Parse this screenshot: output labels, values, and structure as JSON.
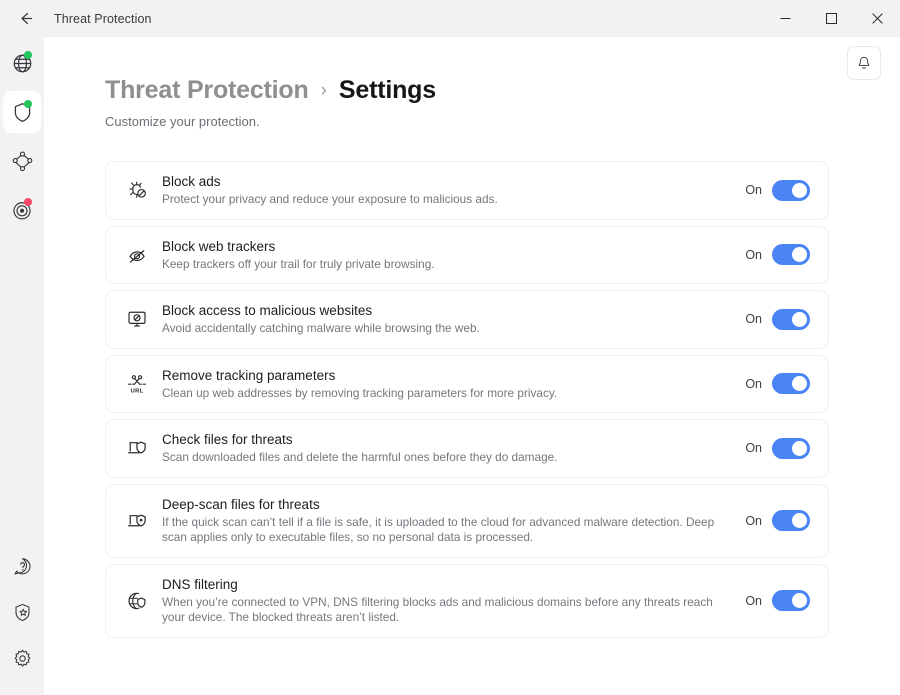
{
  "window": {
    "title": "Threat Protection",
    "back_icon": "back-arrow-icon",
    "minimize_label": "—",
    "maximize_label": "□",
    "close_label": "✕"
  },
  "sidebar": {
    "top_items": [
      {
        "name": "globe-icon",
        "label": "VPN",
        "badge": "green",
        "selected": false
      },
      {
        "name": "shield-icon",
        "label": "Threat Protection",
        "badge": "green",
        "selected": true
      },
      {
        "name": "mesh-network-icon",
        "label": "Meshnet",
        "badge": "none",
        "selected": false
      },
      {
        "name": "radar-icon",
        "label": "Dark Web Monitor",
        "badge": "red",
        "selected": false
      }
    ],
    "bottom_items": [
      {
        "name": "help-icon",
        "label": "Help"
      },
      {
        "name": "shield-star-icon",
        "label": "What's new"
      },
      {
        "name": "gear-icon",
        "label": "Settings"
      }
    ]
  },
  "header": {
    "notification_icon": "bell-icon",
    "breadcrumb_parent": "Threat Protection",
    "breadcrumb_separator": "›",
    "breadcrumb_current": "Settings",
    "subtitle": "Customize your protection."
  },
  "accent_color": "#4a84f5",
  "settings": [
    {
      "icon": "bug-blocked-icon",
      "title": "Block ads",
      "description": "Protect your privacy and reduce your exposure to malicious ads.",
      "state_label": "On",
      "enabled": true
    },
    {
      "icon": "eye-off-icon",
      "title": "Block web trackers",
      "description": "Keep trackers off your trail for truly private browsing.",
      "state_label": "On",
      "enabled": true
    },
    {
      "icon": "monitor-blocked-icon",
      "title": "Block access to malicious websites",
      "description": "Avoid accidentally catching malware while browsing the web.",
      "state_label": "On",
      "enabled": true
    },
    {
      "icon": "url-scissors-icon",
      "title": "Remove tracking parameters",
      "description": "Clean up web addresses by removing tracking parameters for more privacy.",
      "state_label": "On",
      "enabled": true
    },
    {
      "icon": "laptop-shield-icon",
      "title": "Check files for threats",
      "description": "Scan downloaded files and delete the harmful ones before they do damage.",
      "state_label": "On",
      "enabled": true
    },
    {
      "icon": "laptop-shield-dot-icon",
      "title": "Deep-scan files for threats",
      "description": "If the quick scan can’t tell if a file is safe, it is uploaded to the cloud for advanced malware detection. Deep scan applies only to executable files, so no personal data is processed.",
      "state_label": "On",
      "enabled": true
    },
    {
      "icon": "globe-shield-icon",
      "title": "DNS filtering",
      "description": "When you’re connected to VPN, DNS filtering blocks ads and malicious domains before any threats reach your device. The blocked threats aren’t listed.",
      "state_label": "On",
      "enabled": true
    }
  ]
}
